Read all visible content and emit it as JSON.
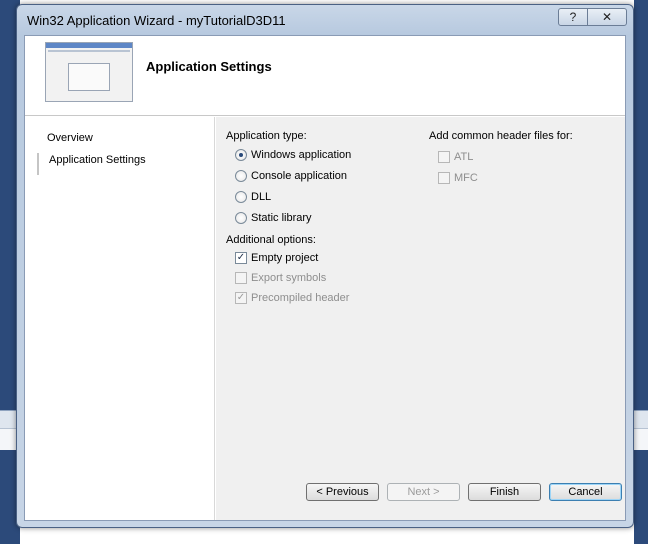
{
  "window": {
    "title": "Win32 Application Wizard - myTutorialD3D11"
  },
  "caption_buttons": {
    "help": "?",
    "close": "✕"
  },
  "header": {
    "title": "Application Settings"
  },
  "nav": {
    "items": [
      "Overview",
      "Application Settings"
    ]
  },
  "app_type": {
    "label": "Application type:",
    "options": [
      {
        "label": "Windows application",
        "selected": true
      },
      {
        "label": "Console application",
        "selected": false
      },
      {
        "label": "DLL",
        "selected": false
      },
      {
        "label": "Static library",
        "selected": false
      }
    ]
  },
  "additional": {
    "label": "Additional options:",
    "options": [
      {
        "label": "Empty project",
        "checked": true,
        "enabled": true
      },
      {
        "label": "Export symbols",
        "checked": false,
        "enabled": false
      },
      {
        "label": "Precompiled header",
        "checked": true,
        "enabled": false
      }
    ]
  },
  "headers": {
    "label": "Add common header files for:",
    "options": [
      {
        "label": "ATL",
        "checked": false,
        "enabled": false
      },
      {
        "label": "MFC",
        "checked": false,
        "enabled": false
      }
    ]
  },
  "footer": {
    "previous": "< Previous",
    "next": "Next >",
    "finish": "Finish",
    "cancel": "Cancel"
  }
}
